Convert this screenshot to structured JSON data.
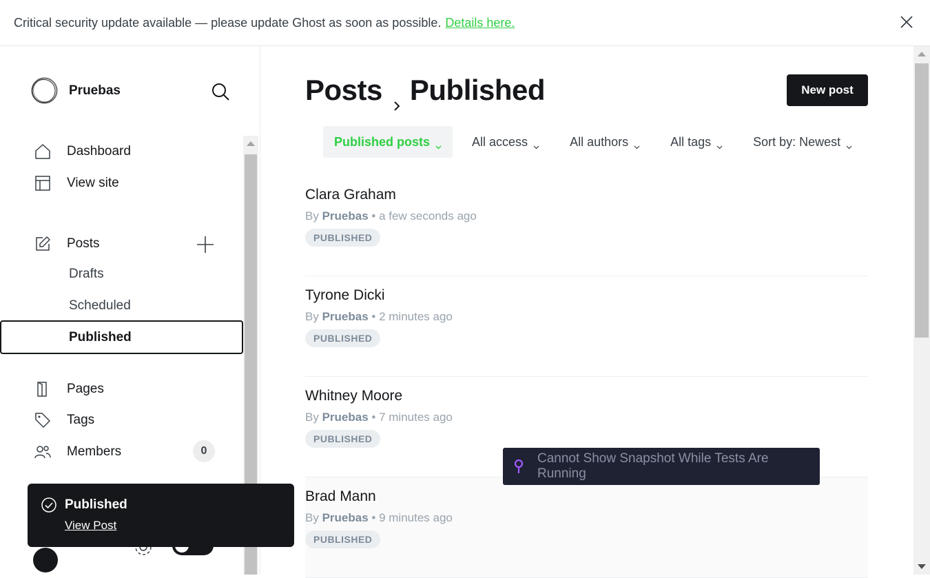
{
  "banner": {
    "message": "Critical security update available — please update Ghost as soon as possible.",
    "link_label": "Details here."
  },
  "sidebar": {
    "site_name": "Pruebas",
    "nav": [
      {
        "label": "Dashboard",
        "icon": "home-icon"
      },
      {
        "label": "View site",
        "icon": "layout-icon"
      },
      {
        "label": "Posts",
        "icon": "edit-icon"
      },
      {
        "label": "Pages",
        "icon": "page-icon"
      },
      {
        "label": "Tags",
        "icon": "tag-icon"
      },
      {
        "label": "Members",
        "icon": "members-icon"
      }
    ],
    "posts_sub": [
      "Drafts",
      "Scheduled",
      "Published"
    ],
    "members_count": "0"
  },
  "toast": {
    "title": "Published",
    "link_label": "View Post"
  },
  "main": {
    "breadcrumb_root": "Posts",
    "breadcrumb_current": "Published",
    "new_post_label": "New post",
    "filters": [
      "Published posts",
      "All access",
      "All authors",
      "All tags",
      "Sort by: Newest"
    ],
    "by_prefix": "By",
    "posts": [
      {
        "title": "Clara Graham",
        "author": "Pruebas",
        "time": "a few seconds ago",
        "status": "PUBLISHED"
      },
      {
        "title": "Tyrone Dicki",
        "author": "Pruebas",
        "time": "2 minutes ago",
        "status": "PUBLISHED"
      },
      {
        "title": "Whitney Moore",
        "author": "Pruebas",
        "time": "7 minutes ago",
        "status": "PUBLISHED"
      },
      {
        "title": "Brad Mann",
        "author": "Pruebas",
        "time": "9 minutes ago",
        "status": "PUBLISHED"
      }
    ]
  },
  "tooltip": {
    "text": "Cannot Show Snapshot While Tests Are Running"
  },
  "colors": {
    "accent": "#30cf43",
    "dark": "#15171a",
    "tooltip_bg": "#1e2233",
    "pin": "#a259ff"
  }
}
